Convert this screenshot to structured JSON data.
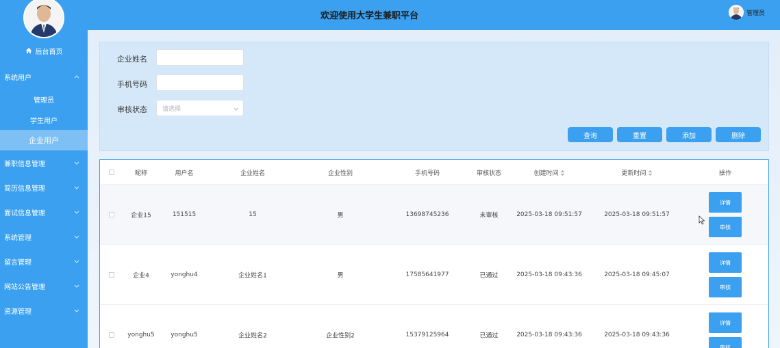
{
  "sidebar": {
    "home_label": "后台首页",
    "menu": [
      {
        "label": "系统用户",
        "expanded": true,
        "children": [
          "管理员",
          "学生用户",
          "企业用户"
        ],
        "active_child": "企业用户"
      },
      {
        "label": "兼职信息管理"
      },
      {
        "label": "简历信息管理"
      },
      {
        "label": "面试信息管理"
      },
      {
        "label": "系统管理"
      },
      {
        "label": "留言管理"
      },
      {
        "label": "网站公告管理"
      },
      {
        "label": "资源管理"
      }
    ]
  },
  "header": {
    "title": "欢迎使用大学生兼职平台",
    "user_label": "管理员"
  },
  "search": {
    "fields": [
      {
        "label": "企业姓名",
        "value": "",
        "placeholder": ""
      },
      {
        "label": "手机号码",
        "value": "",
        "placeholder": ""
      },
      {
        "label": "审核状态",
        "placeholder": "请选择"
      }
    ],
    "buttons": [
      "查询",
      "重置",
      "添加",
      "删除"
    ]
  },
  "table": {
    "columns": [
      "昵称",
      "用户名",
      "企业姓名",
      "企业性别",
      "手机号码",
      "审核状态",
      "创建时间",
      "更新时间",
      "操作"
    ],
    "rows": [
      {
        "nickname": "企业15",
        "username": "151515",
        "name": "15",
        "gender": "男",
        "phone": "13698745236",
        "status": "未审核",
        "created": "2025-03-18 09:51:57",
        "updated": "2025-03-18 09:51:57"
      },
      {
        "nickname": "企业4",
        "username": "yonghu4",
        "name": "企业姓名1",
        "gender": "男",
        "phone": "17585641977",
        "status": "已通过",
        "created": "2025-03-18 09:43:36",
        "updated": "2025-03-18 09:45:07"
      },
      {
        "nickname": "yonghu5",
        "username": "yonghu5",
        "name": "企业姓名2",
        "gender": "企业性别2",
        "phone": "15379125964",
        "status": "已通过",
        "created": "2025-03-18 09:43:36",
        "updated": "2025-03-18 09:43:36"
      }
    ],
    "actions": [
      "详情",
      "审核"
    ]
  },
  "colors": {
    "primary": "#3aa0ef",
    "active_menu": "#7ec0f3"
  }
}
